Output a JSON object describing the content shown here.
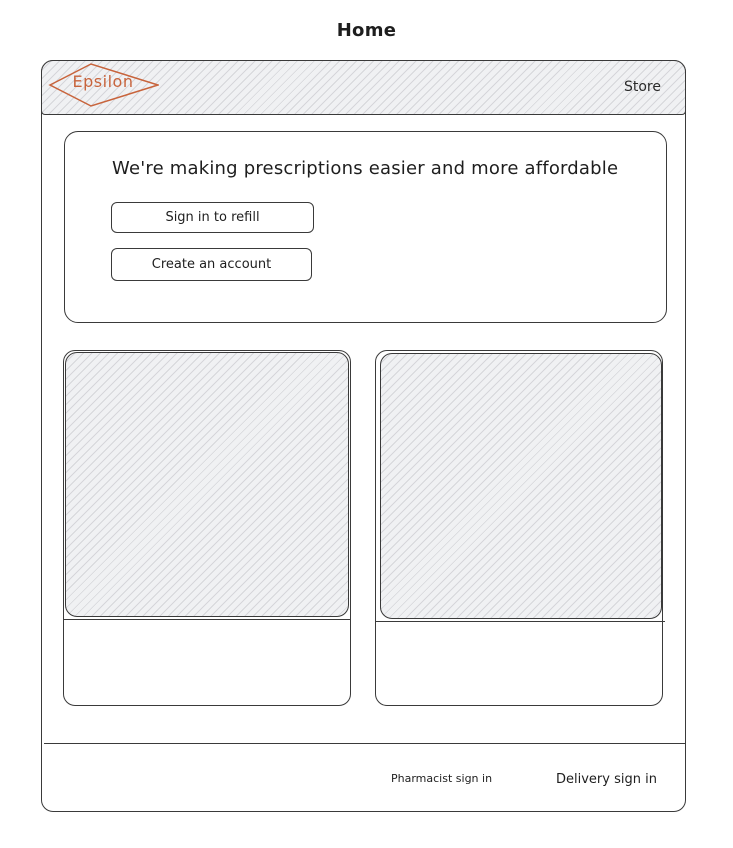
{
  "page": {
    "title": "Home"
  },
  "header": {
    "logo_text": "Epsilon",
    "store_label": "Store"
  },
  "hero": {
    "headline": "We're making prescriptions easier and more affordable",
    "signin_label": "Sign in to refill",
    "create_label": "Create an account"
  },
  "footer": {
    "pharmacist_label": "Pharmacist sign in",
    "delivery_label": "Delivery sign in"
  },
  "colors": {
    "logo": "#c8643c",
    "stroke": "#3a3a3a",
    "placeholder_fill": "#f0f1f3"
  }
}
